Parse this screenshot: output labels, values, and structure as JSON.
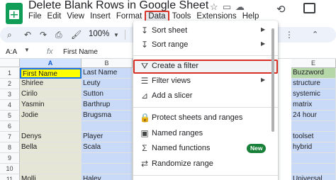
{
  "app": {
    "title": "Delete Blank Rows in Google Sheet",
    "menus": [
      "File",
      "Edit",
      "View",
      "Insert",
      "Format",
      "Data",
      "Tools",
      "Extensions",
      "Help"
    ],
    "active_menu": "Data"
  },
  "toolbar": {
    "zoom": "100%"
  },
  "formula_bar": {
    "name_box": "A:A",
    "fx_label": "fx",
    "content": "First Name"
  },
  "grid": {
    "column_headers": [
      "A",
      "B",
      "E"
    ],
    "row_numbers": [
      "1",
      "2",
      "3",
      "4",
      "5",
      "6",
      "7",
      "8",
      "9",
      "10",
      "11"
    ],
    "col_a": [
      "First Name",
      "Shirlee",
      "Cirilo",
      "Yasmin",
      "Jodie",
      "",
      "Denys",
      "Bella",
      "",
      "",
      "Molli"
    ],
    "col_b": [
      "Last Name",
      "Leuty",
      "Sutton",
      "Barthrup",
      "Brugsma",
      "",
      "Player",
      "Scala",
      "",
      "",
      "Haley"
    ],
    "col_e": [
      "Buzzword",
      "structure",
      "systemic",
      "matrix",
      "24 hour",
      "",
      "toolset",
      "hybrid",
      "",
      "",
      "Universal"
    ]
  },
  "data_menu": {
    "items": [
      {
        "label": "Sort sheet",
        "icon": "sort-icon",
        "submenu": true
      },
      {
        "label": "Sort range",
        "icon": "sort-range-icon",
        "submenu": true
      },
      {
        "label": "Create a filter",
        "icon": "filter-icon",
        "submenu": false,
        "highlighted": true
      },
      {
        "label": "Filter views",
        "icon": "filter-views-icon",
        "submenu": true
      },
      {
        "label": "Add a slicer",
        "icon": "slicer-icon",
        "submenu": false
      },
      {
        "label": "Protect sheets and ranges",
        "icon": "lock-icon",
        "submenu": false
      },
      {
        "label": "Named ranges",
        "icon": "named-ranges-icon",
        "submenu": false
      },
      {
        "label": "Named functions",
        "icon": "sigma-icon",
        "submenu": false,
        "badge": "New"
      },
      {
        "label": "Randomize range",
        "icon": "shuffle-icon",
        "submenu": false
      }
    ]
  },
  "colors": {
    "highlight_border": "#d93025",
    "header_yellow": "#ffff00",
    "col_a_fill": "#e6e6d6",
    "col_b_fill": "#c9daf8",
    "badge_green": "#188038"
  }
}
